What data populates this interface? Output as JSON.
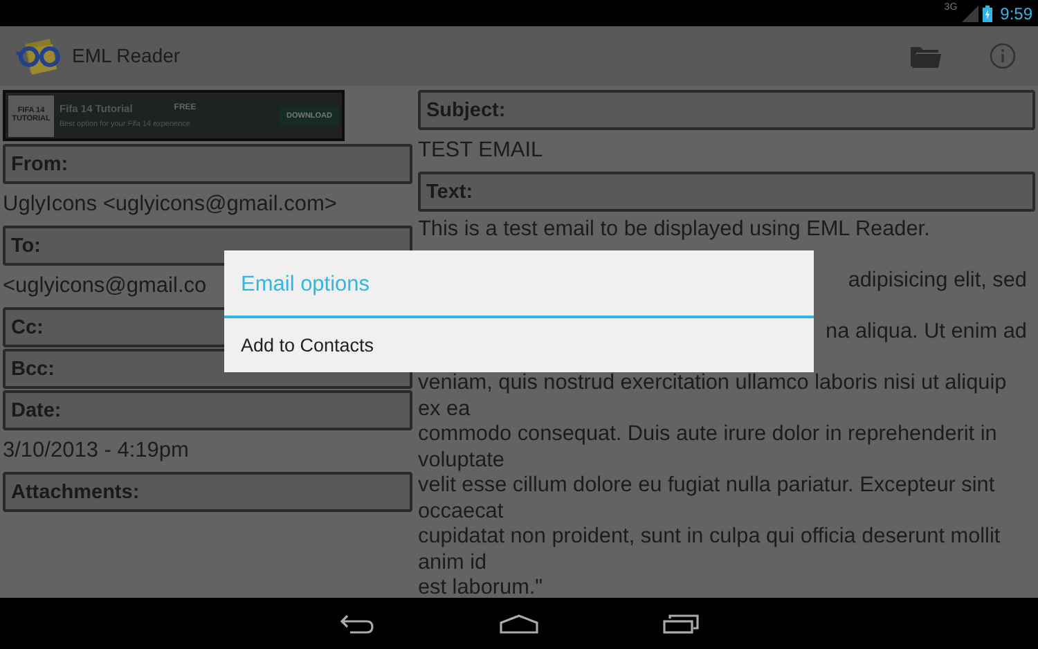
{
  "status_bar": {
    "network": "3G",
    "time": "9:59"
  },
  "action_bar": {
    "title": "EML Reader"
  },
  "ad": {
    "logo_lines": [
      "FIFA 14",
      "TUTORIAL"
    ],
    "title": "Fifa 14 Tutorial",
    "tag": "FREE",
    "subtitle": "Best option for your Fifa 14 experience",
    "button": "DOWNLOAD"
  },
  "left_fields": [
    {
      "label": "From:",
      "value": "UglyIcons <uglyicons@gmail.com>"
    },
    {
      "label": "To:",
      "value": "<uglyicons@gmail.co"
    },
    {
      "label": "Cc:"
    },
    {
      "label": "Bcc:"
    },
    {
      "label": "Date:",
      "value": "3/10/2013 - 4:19pm"
    },
    {
      "label": "Attachments:"
    }
  ],
  "subject": {
    "label": "Subject:",
    "value": "TEST EMAIL"
  },
  "text": {
    "label": "Text:",
    "lines": [
      {
        "kind": "line",
        "text": "This is a test email to be displayed using EML Reader."
      },
      {
        "kind": "partial",
        "text": "adipisicing elit, sed"
      },
      {
        "kind": "partial",
        "text": "na aliqua. Ut enim ad"
      },
      {
        "kind": "line",
        "text": "veniam, quis nostrud exercitation ullamco laboris nisi ut aliquip"
      },
      {
        "kind": "line",
        "text": "ex ea"
      },
      {
        "kind": "line",
        "text": "commodo consequat. Duis aute irure dolor in reprehenderit in"
      },
      {
        "kind": "line",
        "text": "voluptate"
      },
      {
        "kind": "line",
        "text": "velit esse cillum dolore eu fugiat nulla pariatur. Excepteur sint"
      },
      {
        "kind": "line",
        "text": "occaecat"
      },
      {
        "kind": "line",
        "text": "cupidatat non proident, sunt in culpa qui officia deserunt mollit"
      },
      {
        "kind": "line",
        "text": "anim id"
      },
      {
        "kind": "line",
        "text": "est laborum.\""
      }
    ]
  },
  "dialog": {
    "title": "Email options",
    "items": [
      "Add to Contacts"
    ]
  }
}
